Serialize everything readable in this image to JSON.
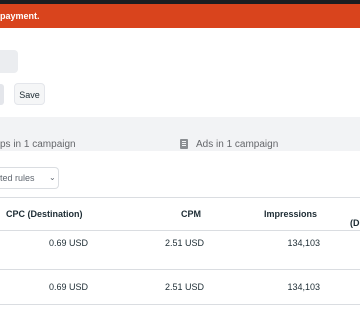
{
  "banner": {
    "text": "payment."
  },
  "toolbar": {
    "save_label": "Save"
  },
  "tabs": [
    {
      "label": "ps in 1 campaign"
    },
    {
      "label": "Ads in 1 campaign"
    }
  ],
  "filters": {
    "rules_label": "ted rules"
  },
  "table": {
    "headers": {
      "cpc": "CPC (Destination)",
      "cpm": "CPM",
      "impressions": "Impressions",
      "partial": "(D"
    },
    "rows": [
      {
        "cpc": "0.69 USD",
        "cpm": "2.51 USD",
        "impressions": "134,103"
      },
      {
        "cpc": "0.69 USD",
        "cpm": "2.51 USD",
        "impressions": "134,103"
      }
    ]
  },
  "colors": {
    "banner_bg": "#d9441d",
    "tabs_bg": "#f2f3f5",
    "text": "#1c2b33"
  }
}
